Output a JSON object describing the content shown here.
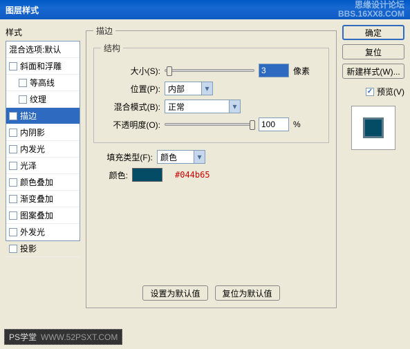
{
  "title": "图层样式",
  "watermark_top": "思缘设计论坛",
  "watermark_sub": "BBS.16XX8.COM",
  "left": {
    "header": "样式",
    "blend_label": "混合选项:默认",
    "items": [
      {
        "label": "斜面和浮雕",
        "checked": false
      },
      {
        "label": "等高线",
        "checked": false,
        "sub": true
      },
      {
        "label": "纹理",
        "checked": false,
        "sub": true
      },
      {
        "label": "描边",
        "checked": true,
        "selected": true
      },
      {
        "label": "内阴影",
        "checked": false
      },
      {
        "label": "内发光",
        "checked": false
      },
      {
        "label": "光泽",
        "checked": false
      },
      {
        "label": "颜色叠加",
        "checked": false
      },
      {
        "label": "渐变叠加",
        "checked": false
      },
      {
        "label": "图案叠加",
        "checked": false
      },
      {
        "label": "外发光",
        "checked": false
      },
      {
        "label": "投影",
        "checked": false
      }
    ]
  },
  "middle": {
    "group_title": "描边",
    "struct_title": "结构",
    "size_label": "大小(S):",
    "size_value": "3",
    "size_unit": "像素",
    "position_label": "位置(P):",
    "position_value": "内部",
    "blend_label": "混合模式(B):",
    "blend_value": "正常",
    "opacity_label": "不透明度(O):",
    "opacity_value": "100",
    "opacity_unit": "%",
    "fill_label": "填充类型(F):",
    "fill_value": "颜色",
    "color_label": "颜色:",
    "color_hex": "#044b65",
    "btn_default": "设置为默认值",
    "btn_reset": "复位为默认值"
  },
  "right": {
    "ok": "确定",
    "cancel": "复位",
    "new_style": "新建样式(W)...",
    "preview": "预览(V)"
  },
  "footer": {
    "brand": "PS学堂",
    "url": "WWW.52PSXT.COM"
  }
}
